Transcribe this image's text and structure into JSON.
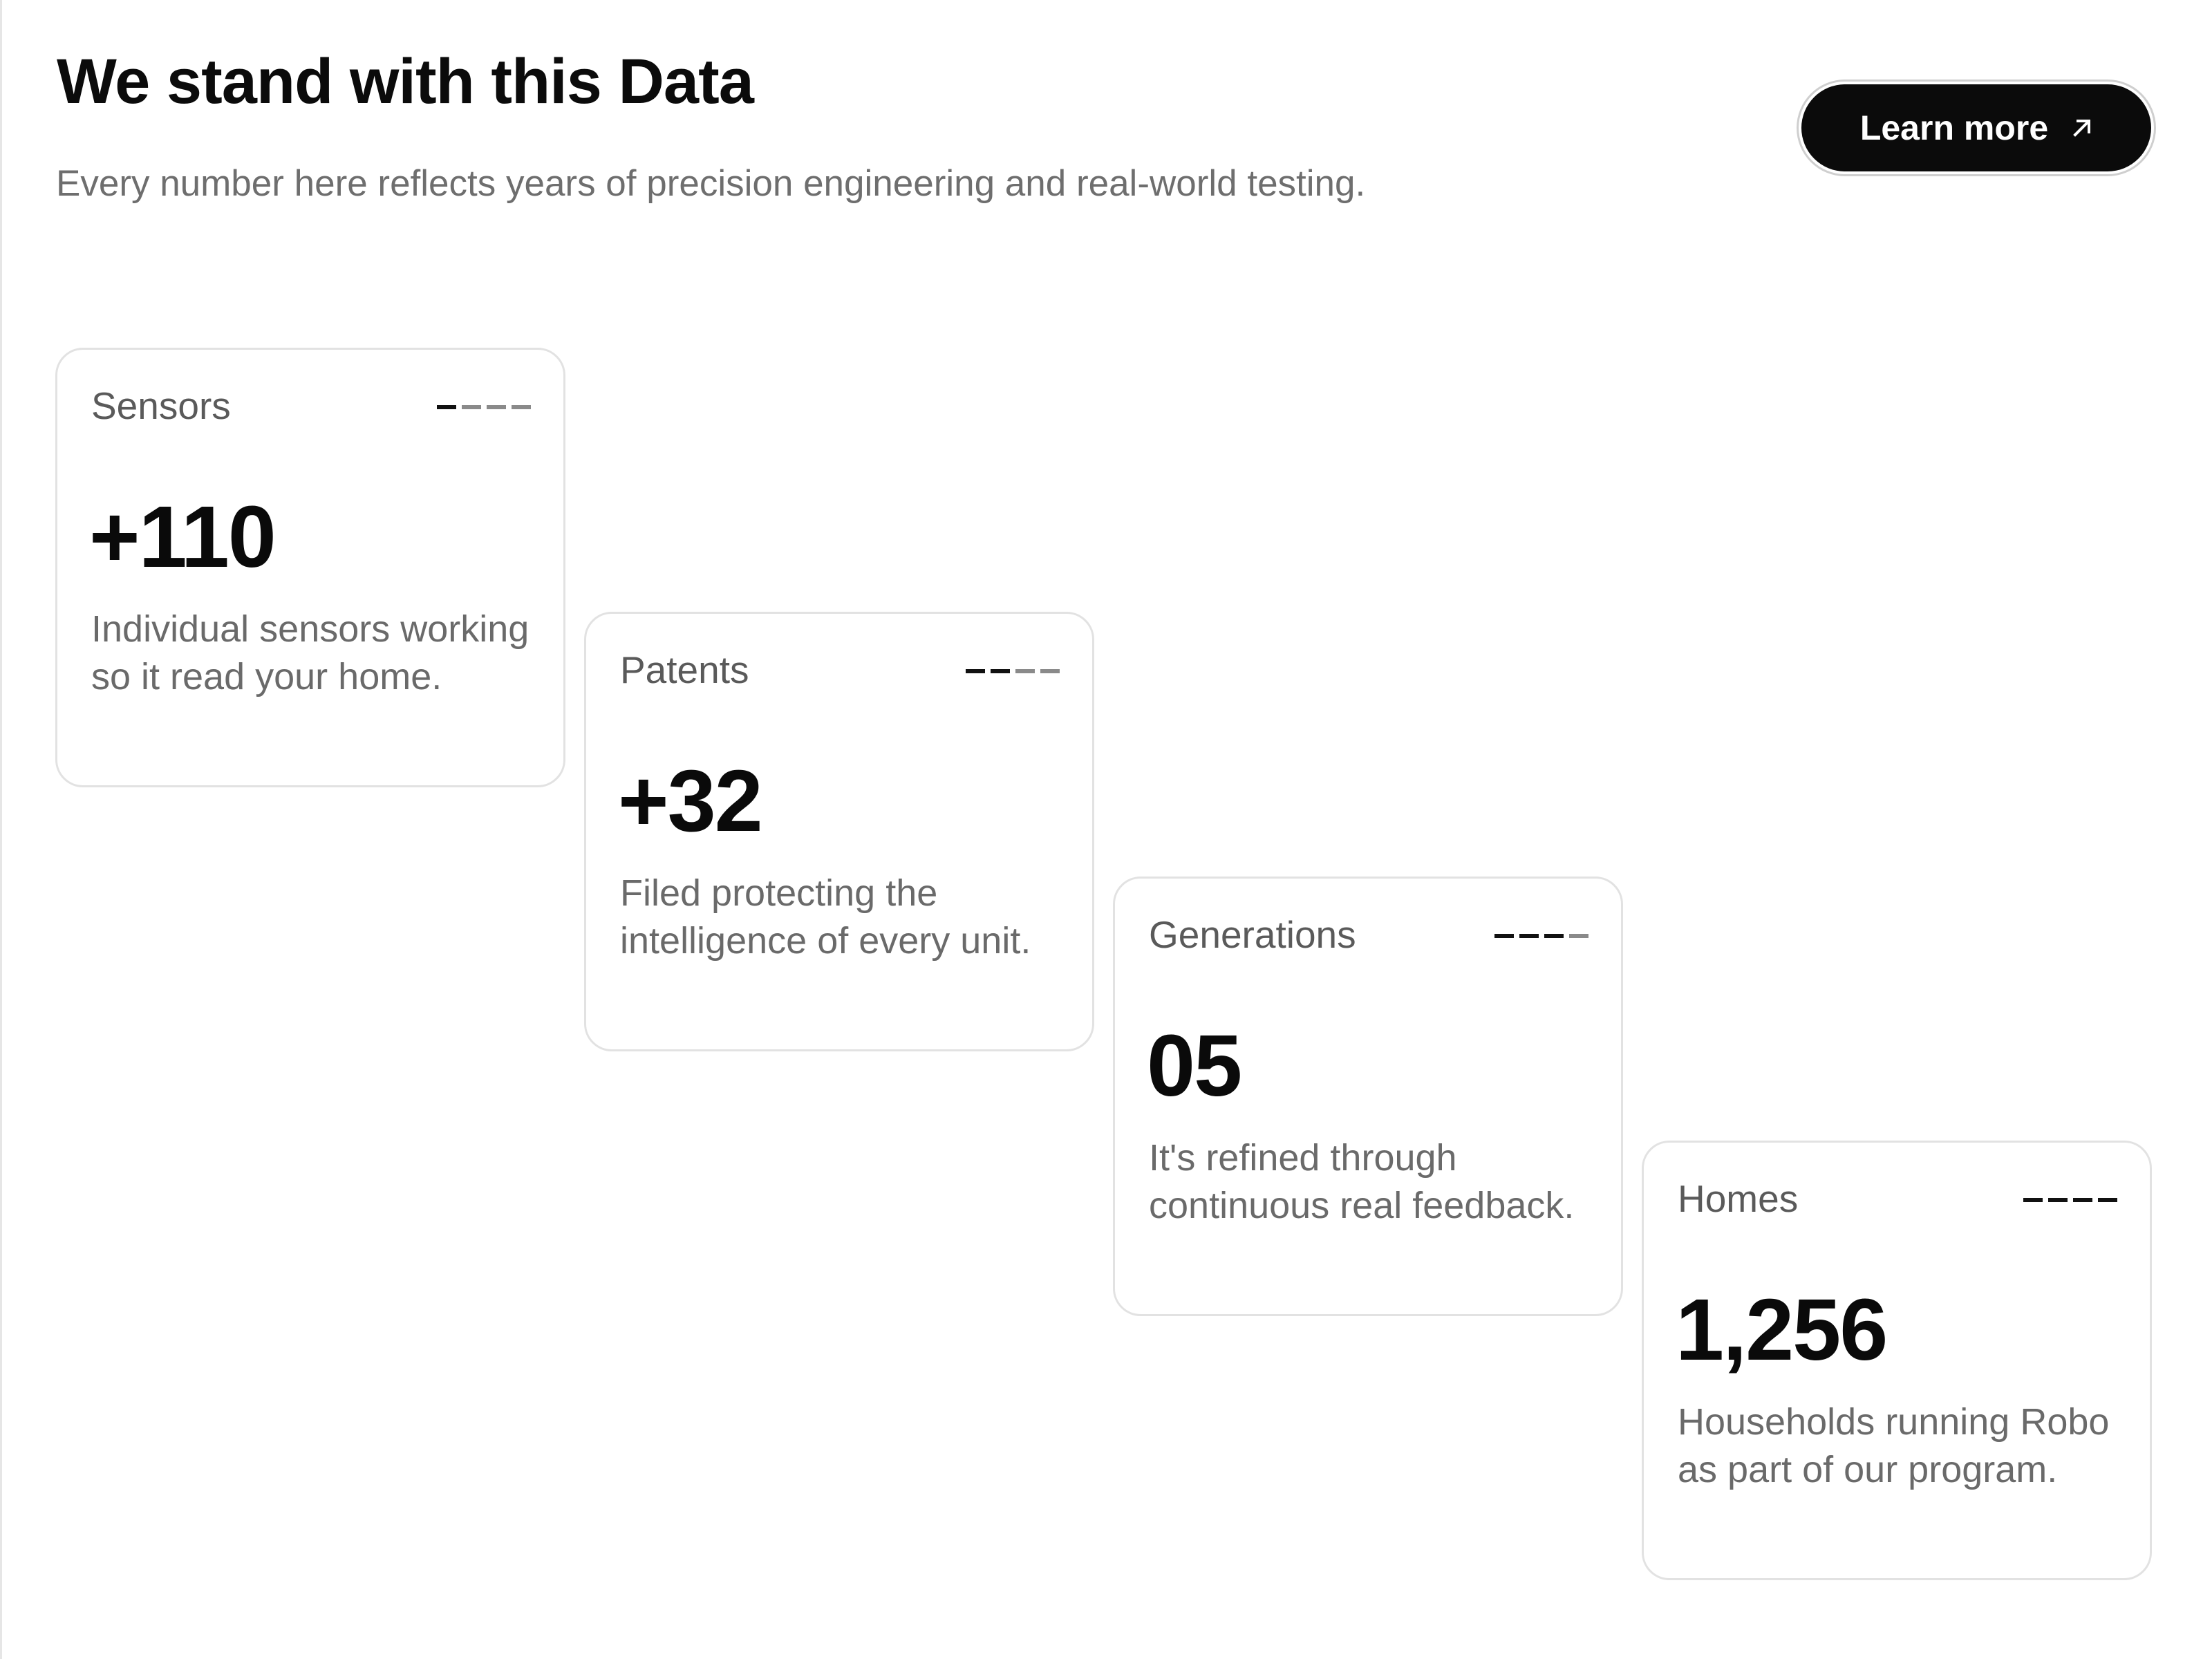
{
  "header": {
    "title": "We stand with this Data",
    "subtitle": "Every number here reflects years of precision engineering and real-world testing.",
    "cta_label": "Learn more"
  },
  "stats": [
    {
      "label": "Sensors",
      "value": "+110",
      "description": "Individual sensors working so it read your home."
    },
    {
      "label": "Patents",
      "value": "+32",
      "description": "Filed protecting the intelligence of every unit."
    },
    {
      "label": "Generations",
      "value": "05",
      "description": "It's refined through continuous real feedback."
    },
    {
      "label": "Homes",
      "value": "1,256",
      "description": "Households running Robo as part of our program."
    }
  ],
  "colors": {
    "button_bg": "#0b0b0b",
    "button_text": "#ffffff",
    "card_border": "#e2e2e2",
    "muted_text": "#6a6a6a"
  },
  "icons": {
    "cta_icon": "arrow-up-right-icon",
    "card_icon": "dashes-icon"
  }
}
